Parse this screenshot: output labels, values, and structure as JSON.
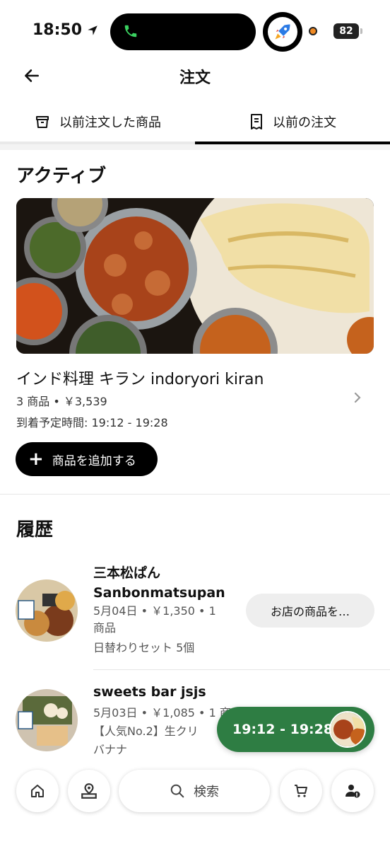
{
  "status_bar": {
    "time": "18:50",
    "battery": "82"
  },
  "header": {
    "title": "注文"
  },
  "tabs": [
    {
      "label": "以前注文した商品",
      "icon": "bag-icon",
      "active": false
    },
    {
      "label": "以前の注文",
      "icon": "receipt-icon",
      "active": true
    }
  ],
  "active": {
    "section_title": "アクティブ",
    "order": {
      "shop_name": "インド料理 キラン indoryori kiran",
      "summary": "3 商品 • ￥3,539",
      "eta": "到着予定時間: 19:12 - 19:28",
      "add_button_label": "商品を追加する"
    }
  },
  "history": {
    "section_title": "履歴",
    "orders": [
      {
        "shop_name_line1": "三本松ぱん",
        "shop_name_line2": "Sanbonmatsupan",
        "meta_line1": "5月04日 • ￥1,350 • 1",
        "meta_line2": "商品",
        "items": "日替わりセット 5個",
        "store_button_label": "お店の商品を…"
      },
      {
        "shop_name_line1": "sweets bar jsjs",
        "meta_line1": "5月03日 • ￥1,085 • 1 商",
        "meta_line2": "【人気No.2】生クリ",
        "meta_line3": "バナナ"
      }
    ]
  },
  "eta_pill": {
    "label": "19:12 - 19:28"
  },
  "bottom_nav": {
    "search_label": "検索",
    "buttons": [
      "home-icon",
      "pickup-icon",
      "cart-icon",
      "account-icon"
    ]
  },
  "colors": {
    "accent_green": "#2e7d43",
    "primary": "#000000"
  }
}
